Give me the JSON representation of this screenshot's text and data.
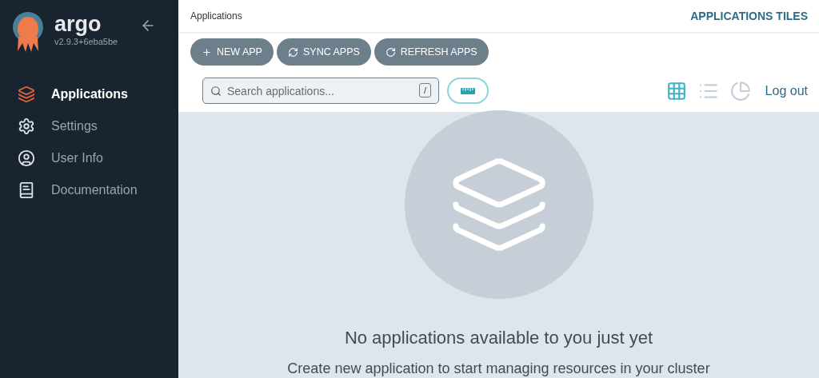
{
  "sidebar": {
    "logo": "argo",
    "version": "v2.9.3+6eba5be",
    "items": [
      {
        "kind": "layers",
        "label": "Applications",
        "selected": true
      },
      {
        "kind": "gear",
        "label": "Settings",
        "selected": false
      },
      {
        "kind": "user",
        "label": "User Info",
        "selected": false
      },
      {
        "kind": "book",
        "label": "Documentation",
        "selected": false
      }
    ]
  },
  "header": {
    "breadcrumb": "Applications",
    "title": "APPLICATIONS TILES"
  },
  "buttons": [
    {
      "kind": "plus",
      "label": "NEW APP"
    },
    {
      "kind": "sync",
      "label": "SYNC APPS"
    },
    {
      "kind": "refresh",
      "label": "REFRESH APPS"
    }
  ],
  "search": {
    "placeholder": "Search applications...",
    "shortcut": "/"
  },
  "views": [
    {
      "kind": "tiles",
      "selected": true
    },
    {
      "kind": "list",
      "selected": false
    },
    {
      "kind": "summary",
      "selected": false
    }
  ],
  "logout": "Log out",
  "empty": {
    "title": "No applications available to you just yet",
    "subtitle": "Create new application to start managing resources in your cluster"
  }
}
